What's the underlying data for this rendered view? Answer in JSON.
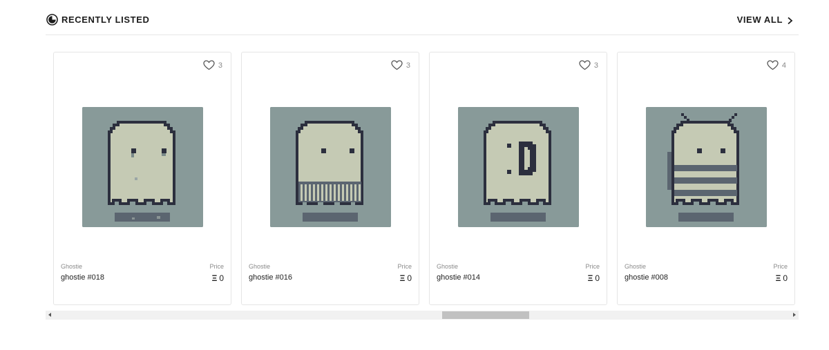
{
  "header": {
    "title": "RECENTLY LISTED",
    "title_icon": "clock-icon",
    "view_all_label": "VIEW ALL",
    "view_all_icon": "chevron-right-icon"
  },
  "colors": {
    "art_background": "#889a99",
    "ghost_body": "#c5cab4",
    "ghost_outline": "#2c2f3e",
    "shadow": "#5b6570"
  },
  "cards": [
    {
      "likes": "3",
      "collection": "Ghostie",
      "name": "ghostie #018",
      "price_label": "Price",
      "price": "0",
      "variant": "plain"
    },
    {
      "likes": "3",
      "collection": "Ghostie",
      "name": "ghostie #016",
      "price_label": "Price",
      "price": "0",
      "variant": "sweater"
    },
    {
      "likes": "3",
      "collection": "Ghostie",
      "name": "ghostie #014",
      "price_label": "Price",
      "price": "0",
      "variant": "smile"
    },
    {
      "likes": "4",
      "collection": "Ghostie",
      "name": "ghostie #008",
      "price_label": "Price",
      "price": "0",
      "variant": "bee"
    }
  ],
  "currency_symbol": "Ξ"
}
